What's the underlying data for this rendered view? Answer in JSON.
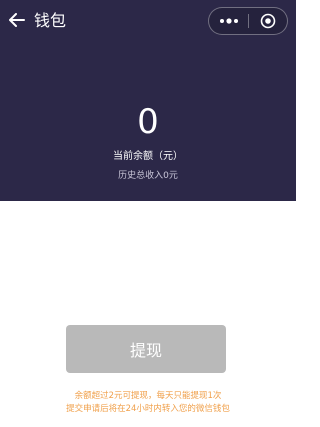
{
  "nav": {
    "title": "钱包",
    "back_icon": "arrow-left-icon",
    "more_icon": "more-dots-icon",
    "close_icon": "target-circle-icon"
  },
  "balance": {
    "amount": "0",
    "label": "当前余额（元）",
    "history": "历史总收入0元"
  },
  "withdraw": {
    "button_label": "提现"
  },
  "tips": {
    "line1": "余额超过2元可提现，每天只能提现1次",
    "line2": "提交申请后将在24小时内转入您的微信钱包"
  },
  "colors": {
    "header_bg": "#2c2848",
    "button_disabled": "#b9b9b9",
    "tip_text": "#f0a04b"
  }
}
